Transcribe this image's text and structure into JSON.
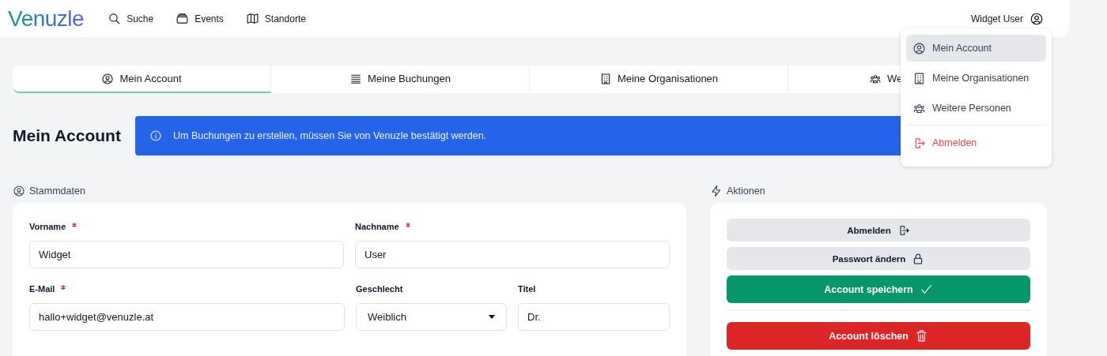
{
  "header": {
    "logo": "Venuzle",
    "nav": [
      {
        "label": "Suche"
      },
      {
        "label": "Events"
      },
      {
        "label": "Standorte"
      }
    ],
    "user": "Widget User"
  },
  "tabs": [
    {
      "label": "Mein Account",
      "selected": true
    },
    {
      "label": "Meine Buchungen",
      "selected": false
    },
    {
      "label": "Meine Organisationen",
      "selected": false
    },
    {
      "label": "We",
      "selected": false
    }
  ],
  "page_title": "Mein Account",
  "banner": {
    "text": "Um Buchungen zu erstellen, müssen Sie von Venuzle bestätigt werden."
  },
  "stammdaten": {
    "title": "Stammdaten",
    "rows": [
      [
        {
          "label": "Vorname",
          "required": true,
          "kind": "text",
          "value": "Widget"
        },
        {
          "label": "Nachname",
          "required": true,
          "kind": "text",
          "value": "User"
        }
      ],
      [
        {
          "label": "E-Mail",
          "required": true,
          "kind": "text",
          "value": "hallo+widget@venuzle.at"
        },
        {
          "label": "Geschlecht",
          "required": false,
          "kind": "select",
          "value": "Weiblich"
        },
        {
          "label": "Titel",
          "required": false,
          "kind": "text",
          "value": "Dr."
        }
      ]
    ]
  },
  "aktionen": {
    "title": "Aktionen",
    "buttons": [
      {
        "label": "Abmelden",
        "kind": "secondary"
      },
      {
        "label": "Passwort ändern",
        "kind": "secondary"
      },
      {
        "label": "Account speichern",
        "kind": "primary"
      },
      {
        "label": "Account löschen",
        "kind": "danger"
      }
    ]
  },
  "user_menu": {
    "items": [
      {
        "label": "Mein Account",
        "kind": "normal",
        "selected": true
      },
      {
        "label": "Meine Organisationen",
        "kind": "normal",
        "selected": false
      },
      {
        "label": "Weitere Personen",
        "kind": "normal",
        "selected": false
      },
      {
        "label": "Abmelden",
        "kind": "danger",
        "selected": false
      }
    ]
  }
}
